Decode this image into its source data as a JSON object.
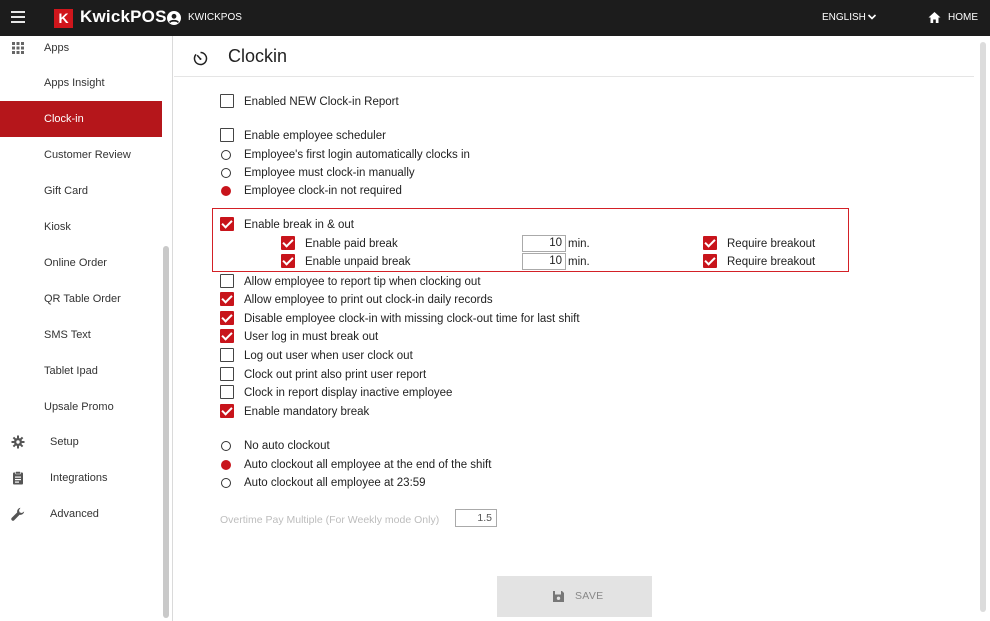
{
  "topbar": {
    "brand_logo": "K",
    "brand": "KwickPOS",
    "store": "KWICKPOS",
    "language": "ENGLISH",
    "home": "HOME"
  },
  "sidebar": {
    "apps_label": "Apps",
    "items": [
      {
        "label": "Apps Insight",
        "active": false
      },
      {
        "label": "Clock-in",
        "active": true
      },
      {
        "label": "Customer Review",
        "active": false
      },
      {
        "label": "Gift Card",
        "active": false
      },
      {
        "label": "Kiosk",
        "active": false
      },
      {
        "label": "Online Order",
        "active": false
      },
      {
        "label": "QR Table Order",
        "active": false
      },
      {
        "label": "SMS Text",
        "active": false
      },
      {
        "label": "Tablet Ipad",
        "active": false
      },
      {
        "label": "Upsale Promo",
        "active": false
      }
    ],
    "sections": [
      {
        "label": "Setup",
        "icon": "gear-icon"
      },
      {
        "label": "Integrations",
        "icon": "clipboard-icon"
      },
      {
        "label": "Advanced",
        "icon": "wrench-icon"
      }
    ]
  },
  "page": {
    "title": "Clockin",
    "icon": "timer-icon"
  },
  "settings": {
    "new_report": {
      "label": "Enabled NEW Clock-in Report",
      "checked": false
    },
    "scheduler": {
      "label": "Enable employee scheduler",
      "checked": false
    },
    "clockin_mode": {
      "options": [
        {
          "label": "Employee's first login automatically clocks in",
          "selected": false
        },
        {
          "label": "Employee must clock-in manually",
          "selected": false
        },
        {
          "label": "Employee clock-in not required",
          "selected": true
        }
      ]
    },
    "break": {
      "label": "Enable break in & out",
      "checked": true,
      "paid": {
        "label": "Enable paid break",
        "checked": true,
        "minutes": "10",
        "unit": "min.",
        "require_label": "Require breakout",
        "require_checked": true
      },
      "unpaid": {
        "label": "Enable unpaid break",
        "checked": true,
        "minutes": "10",
        "unit": "min.",
        "require_label": "Require breakout",
        "require_checked": true
      }
    },
    "options": [
      {
        "label": "Allow employee to report tip when clocking out",
        "checked": false
      },
      {
        "label": "Allow employee to print out clock-in daily records",
        "checked": true
      },
      {
        "label": "Disable employee clock-in with missing clock-out time for last shift",
        "checked": true
      },
      {
        "label": "User log in must break out",
        "checked": true
      },
      {
        "label": "Log out user when user clock out",
        "checked": false
      },
      {
        "label": "Clock out print also print user report",
        "checked": false
      },
      {
        "label": "Clock in report display inactive employee",
        "checked": false
      },
      {
        "label": "Enable mandatory break",
        "checked": true
      }
    ],
    "auto_clockout": {
      "options": [
        {
          "label": "No auto clockout",
          "selected": false
        },
        {
          "label": "Auto clockout all employee at the end of the shift",
          "selected": true
        },
        {
          "label": "Auto clockout all employee at 23:59",
          "selected": false
        }
      ]
    },
    "overtime": {
      "label": "Overtime Pay Multiple (For Weekly mode Only)",
      "value": "1.5"
    }
  },
  "save_button": {
    "label": "SAVE"
  },
  "colors": {
    "accent": "#c8141b",
    "topbar": "#1c1c1c",
    "active_sidebar": "#b5161b"
  }
}
